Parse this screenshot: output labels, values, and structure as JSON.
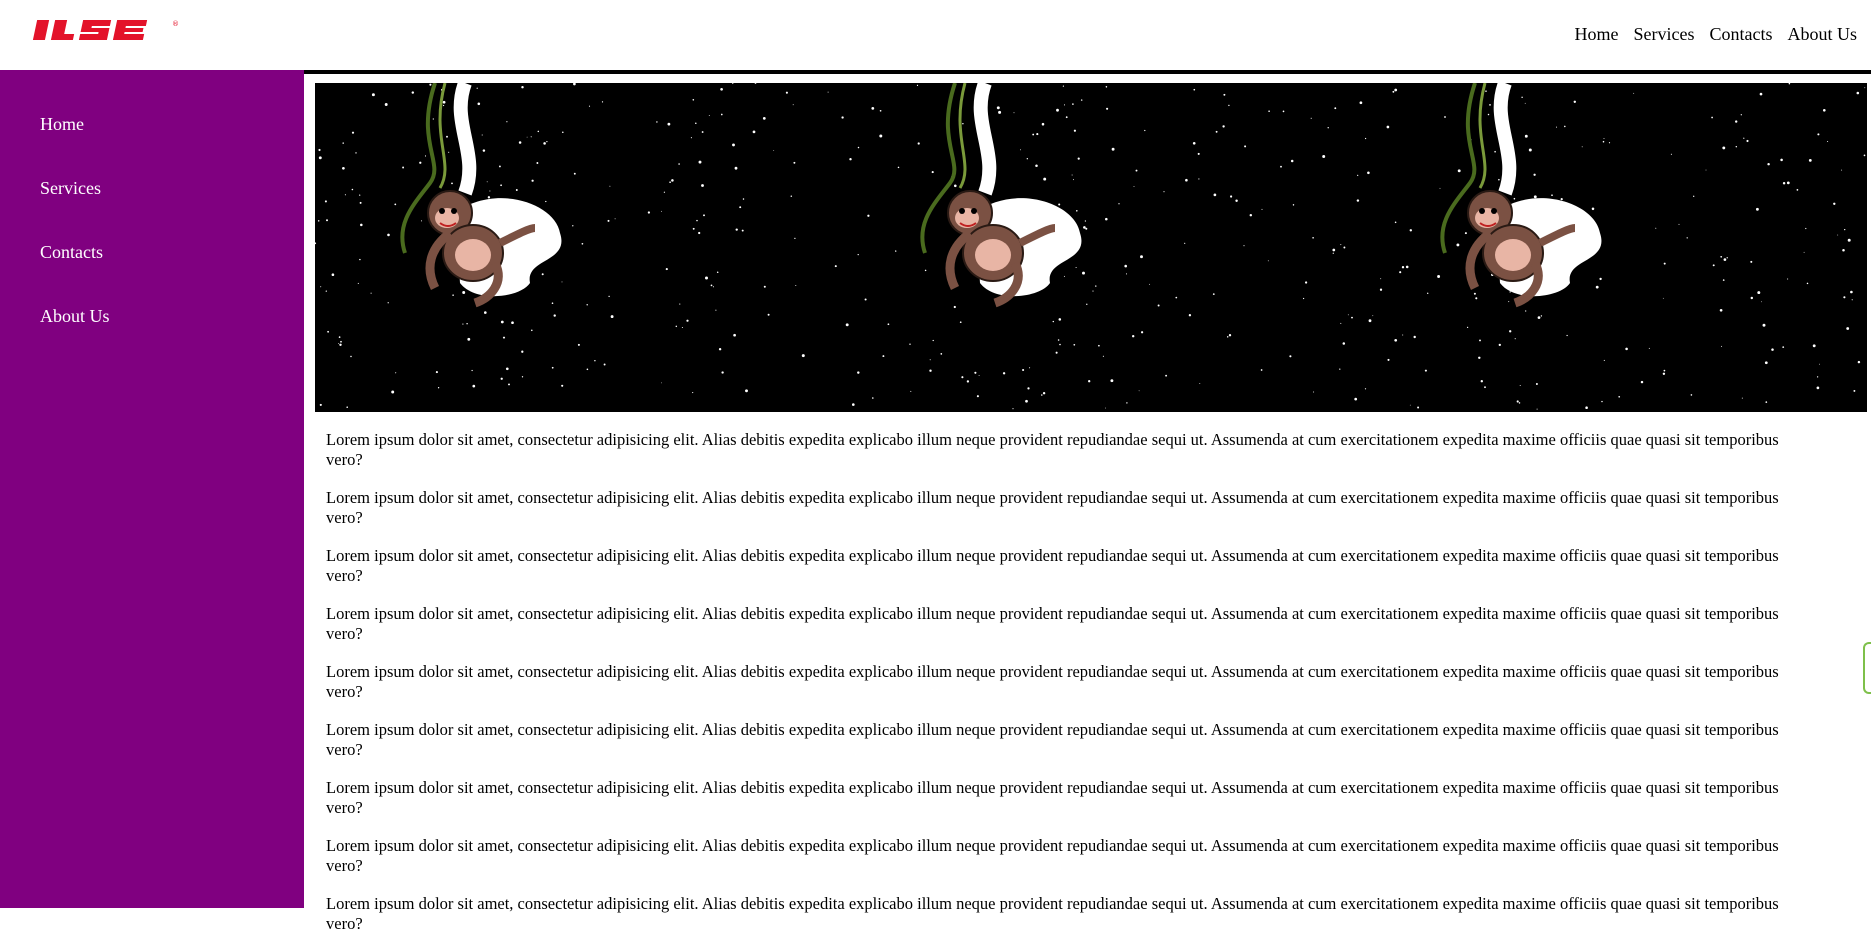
{
  "logo": {
    "text": "IJSE",
    "mark": "®",
    "color": "#e3132a"
  },
  "top_nav": [
    "Home",
    "Services",
    "Contacts",
    "About Us"
  ],
  "sidebar": {
    "color": "#800080",
    "items": [
      "Home",
      "Services",
      "Contacts",
      "About Us"
    ]
  },
  "banner": {
    "description": ""
  },
  "content": {
    "paragraphs": [
      {
        "line1": "Lorem ipsum dolor sit amet, consectetur adipisicing elit. Alias debitis expedita explicabo illum neque provident repudiandae sequi ut. Assumenda at cum exercitationem expedita maxime officiis quae quasi sit temporibus",
        "line2": "vero?"
      },
      {
        "line1": "Lorem ipsum dolor sit amet, consectetur adipisicing elit. Alias debitis expedita explicabo illum neque provident repudiandae sequi ut. Assumenda at cum exercitationem expedita maxime officiis quae quasi sit temporibus",
        "line2": "vero?"
      },
      {
        "line1": "Lorem ipsum dolor sit amet, consectetur adipisicing elit. Alias debitis expedita explicabo illum neque provident repudiandae sequi ut. Assumenda at cum exercitationem expedita maxime officiis quae quasi sit temporibus",
        "line2": "vero?"
      },
      {
        "line1": "Lorem ipsum dolor sit amet, consectetur adipisicing elit. Alias debitis expedita explicabo illum neque provident repudiandae sequi ut. Assumenda at cum exercitationem expedita maxime officiis quae quasi sit temporibus",
        "line2": "vero?"
      },
      {
        "line1": "Lorem ipsum dolor sit amet, consectetur adipisicing elit. Alias debitis expedita explicabo illum neque provident repudiandae sequi ut. Assumenda at cum exercitationem expedita maxime officiis quae quasi sit temporibus",
        "line2": "vero?"
      },
      {
        "line1": "Lorem ipsum dolor sit amet, consectetur adipisicing elit. Alias debitis expedita explicabo illum neque provident repudiandae sequi ut. Assumenda at cum exercitationem expedita maxime officiis quae quasi sit temporibus",
        "line2": "vero?"
      },
      {
        "line1": "Lorem ipsum dolor sit amet, consectetur adipisicing elit. Alias debitis expedita explicabo illum neque provident repudiandae sequi ut. Assumenda at cum exercitationem expedita maxime officiis quae quasi sit temporibus",
        "line2": "vero?"
      },
      {
        "line1": "Lorem ipsum dolor sit amet, consectetur adipisicing elit. Alias debitis expedita explicabo illum neque provident repudiandae sequi ut. Assumenda at cum exercitationem expedita maxime officiis quae quasi sit temporibus",
        "line2": "vero?"
      },
      {
        "line1": "Lorem ipsum dolor sit amet, consectetur adipisicing elit. Alias debitis expedita explicabo illum neque provident repudiandae sequi ut. Assumenda at cum exercitationem expedita maxime officiis quae quasi sit temporibus",
        "line2": "vero?"
      }
    ]
  }
}
